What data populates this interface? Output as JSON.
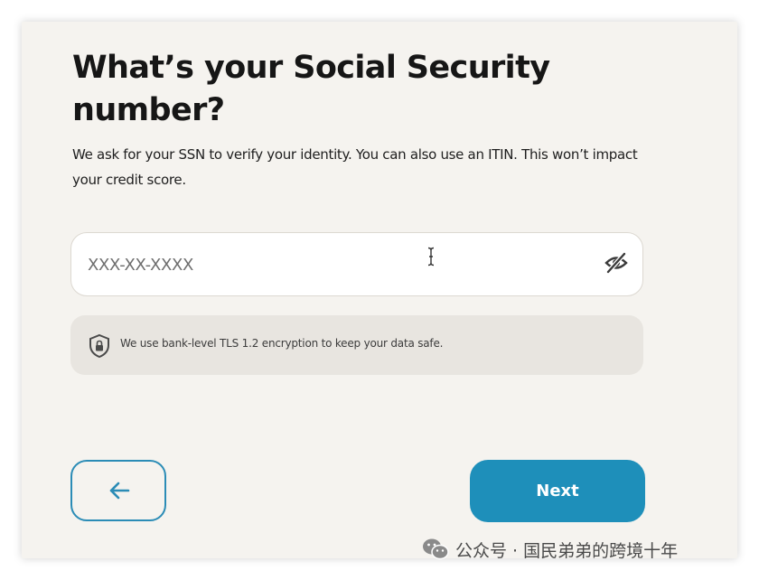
{
  "page": {
    "title": "What’s your Social Security number?",
    "subtitle": "We ask for your SSN to verify your identity. You can also use an ITIN. This won’t impact your credit score."
  },
  "ssn_field": {
    "placeholder": "XXX-XX-XXXX",
    "value": "",
    "visibility_icon": "eye-off-icon",
    "text_cursor_icon": "text-cursor-icon"
  },
  "security_note": {
    "icon": "shield-lock-icon",
    "text": "We use bank-level TLS 1.2 encryption to keep your data safe."
  },
  "navigation": {
    "back_icon": "arrow-left-icon",
    "next_label": "Next"
  },
  "watermark": {
    "icon": "wechat-icon",
    "text": "公众号 · 国民弟弟的跨境十年"
  },
  "colors": {
    "background": "#f5f3ef",
    "accent": "#1e8fba",
    "note_background": "#e8e5e0",
    "text": "#161616"
  }
}
